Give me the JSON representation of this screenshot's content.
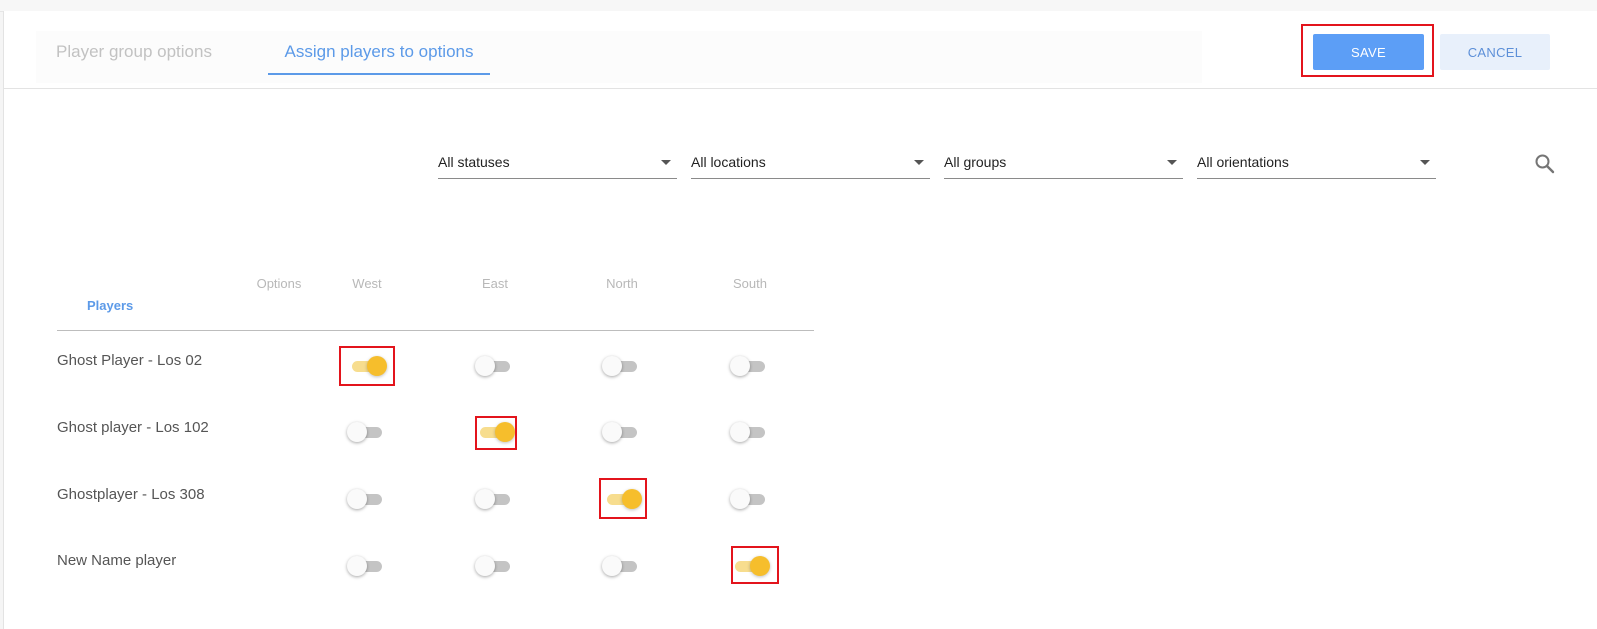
{
  "tabs": [
    {
      "label": "Player group options",
      "active": false
    },
    {
      "label": "Assign players to options",
      "active": true
    }
  ],
  "actions": {
    "save_label": "SAVE",
    "cancel_label": "CANCEL"
  },
  "filters": {
    "status": "All statuses",
    "location": "All locations",
    "group": "All groups",
    "orientation": "All orientations"
  },
  "table": {
    "players_header": "Players",
    "options_header": "Options",
    "columns": [
      "West",
      "East",
      "North",
      "South"
    ],
    "rows": [
      {
        "name": "Ghost Player - Los 02",
        "toggles": [
          true,
          false,
          false,
          false
        ]
      },
      {
        "name": "Ghost player - Los 102",
        "toggles": [
          false,
          true,
          false,
          false
        ]
      },
      {
        "name": "Ghostplayer - Los 308",
        "toggles": [
          false,
          false,
          true,
          false
        ]
      },
      {
        "name": "New Name player",
        "toggles": [
          false,
          false,
          false,
          true
        ]
      }
    ]
  },
  "colors": {
    "accent": "#5c9ae8",
    "save_bg": "#5c9ef6",
    "toggle_on": "#f6be2c",
    "highlight": "#e3141c"
  },
  "icons": {
    "search": "search-icon",
    "dropdown": "caret-down-icon"
  }
}
